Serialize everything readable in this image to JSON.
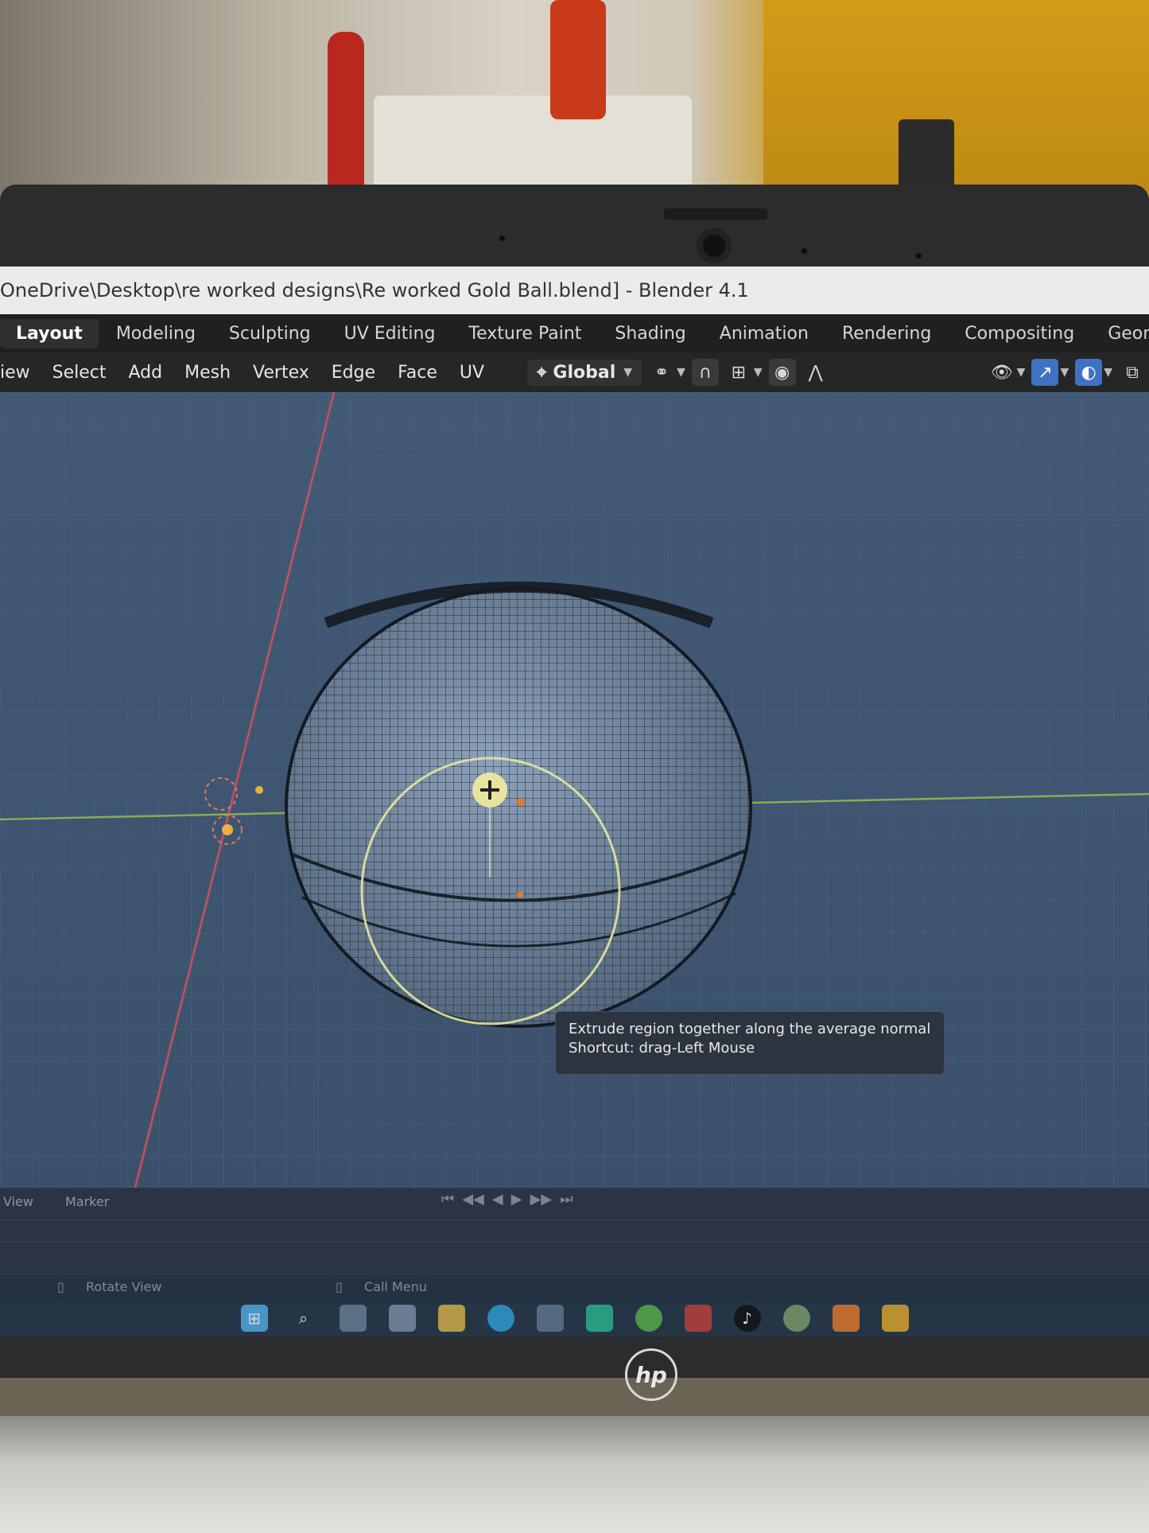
{
  "window": {
    "title": "OneDrive\\Desktop\\re worked designs\\Re worked Gold Ball.blend] - Blender 4.1"
  },
  "workspaces": [
    {
      "label": "Layout",
      "active": true
    },
    {
      "label": "Modeling",
      "active": false
    },
    {
      "label": "Sculpting",
      "active": false
    },
    {
      "label": "UV Editing",
      "active": false
    },
    {
      "label": "Texture Paint",
      "active": false
    },
    {
      "label": "Shading",
      "active": false
    },
    {
      "label": "Animation",
      "active": false
    },
    {
      "label": "Rendering",
      "active": false
    },
    {
      "label": "Compositing",
      "active": false
    },
    {
      "label": "Geomet",
      "active": false
    }
  ],
  "header_menu": [
    "iew",
    "Select",
    "Add",
    "Mesh",
    "Vertex",
    "Edge",
    "Face",
    "UV"
  ],
  "orientation": {
    "label": "Global"
  },
  "header_icons": [
    "pivot-icon",
    "snap-icon",
    "snap-increment-icon",
    "proportional-edit-icon",
    "falloff-icon",
    "visibility-icon",
    "gizmo-icon",
    "overlay-icon",
    "xray-icon"
  ],
  "tooltip": {
    "line1": "Extrude region together along the average normal",
    "line2": "Shortcut: drag-Left Mouse"
  },
  "timeline": {
    "menu": [
      "View",
      "Marker"
    ]
  },
  "status_bar": {
    "left": "Rotate View",
    "middle": "Call Menu"
  },
  "colors": {
    "accent_blue": "#3f72c4",
    "x_axis": "#d0525f",
    "y_axis": "#9cc14a",
    "gizmo_yellow": "#e8e4a0"
  },
  "logo": "hp"
}
